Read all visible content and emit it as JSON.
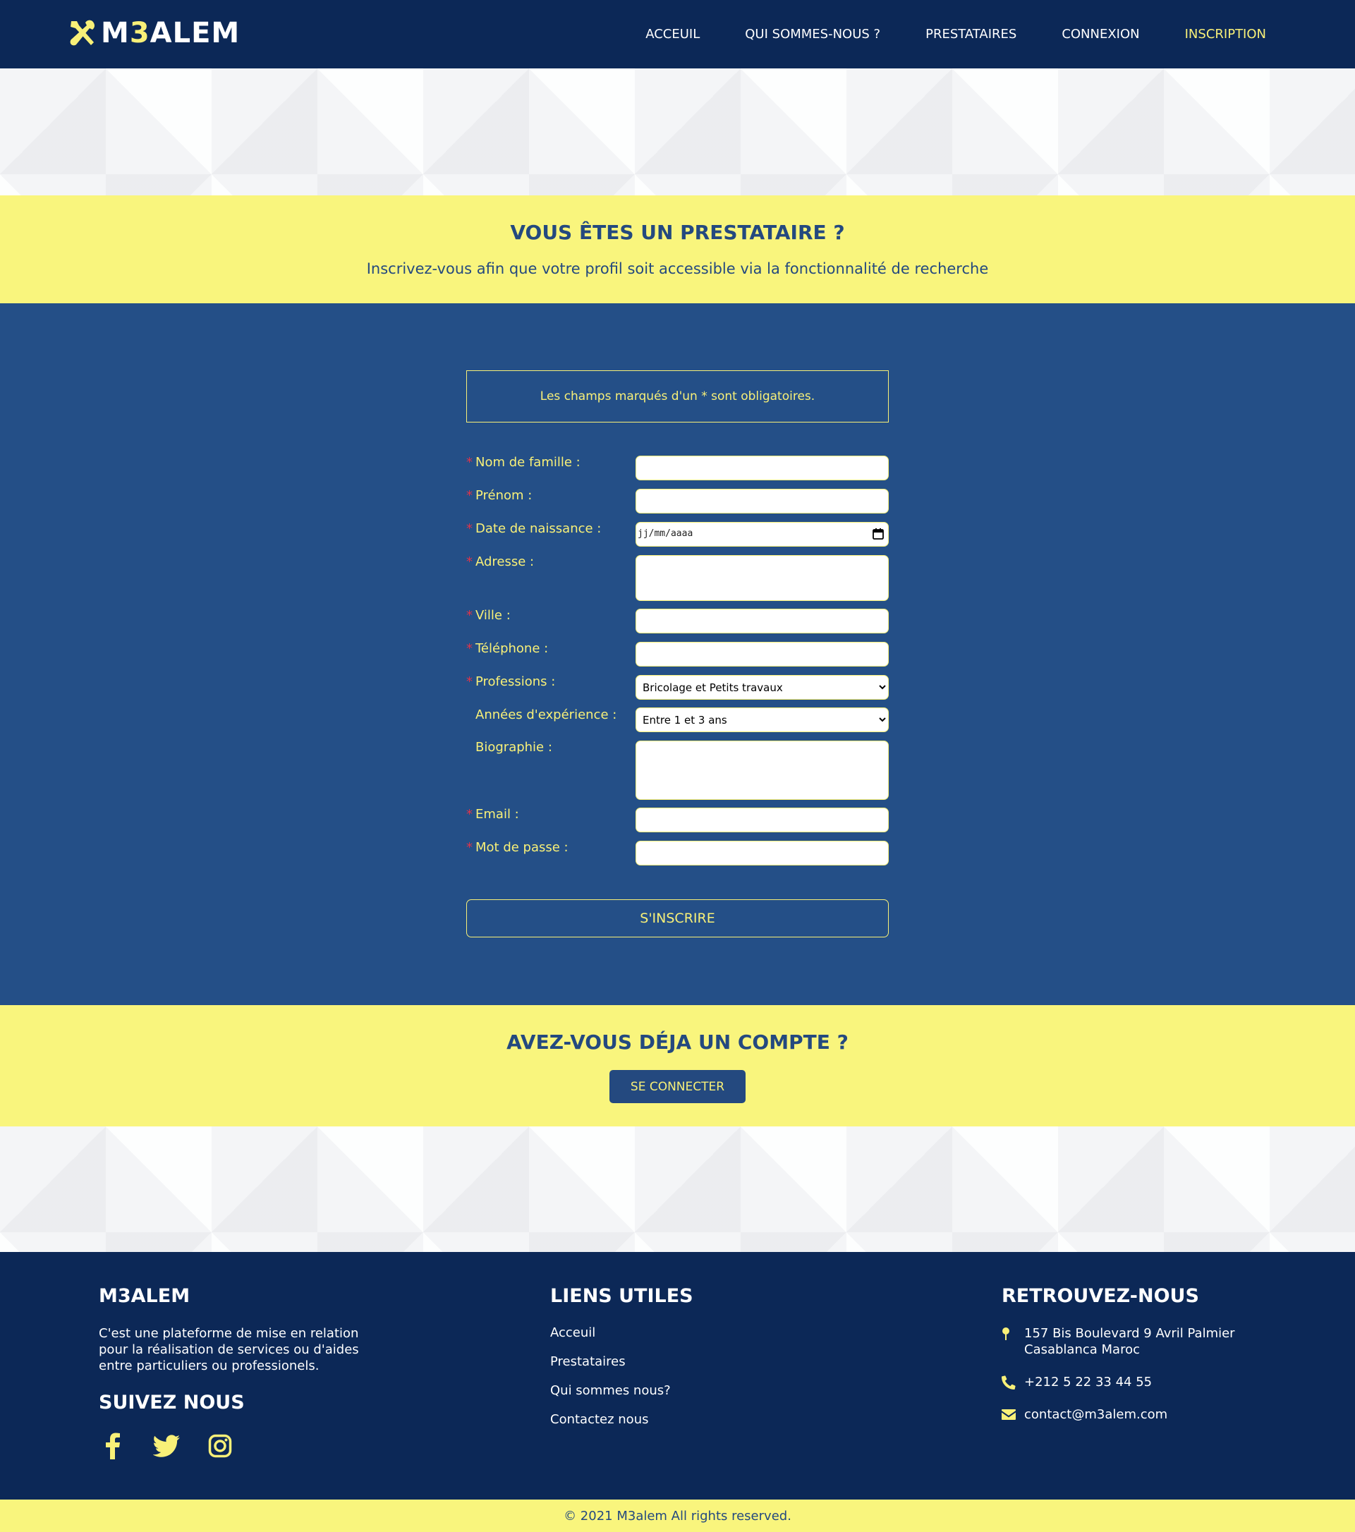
{
  "brand": {
    "logo_main": "M",
    "logo_accent": "3",
    "logo_end": "ALEM"
  },
  "nav": {
    "items": [
      {
        "label": "ACCEUIL"
      },
      {
        "label": "QUI SOMMES-NOUS ?"
      },
      {
        "label": "PRESTATAIRES"
      },
      {
        "label": "CONNEXION"
      },
      {
        "label": "INSCRIPTION"
      }
    ],
    "active_index": 4
  },
  "hero": {
    "title": "VOUS ÊTES UN PRESTATAIRE ?",
    "subtitle": "Inscrivez-vous afin que votre profil soit accessible via la fonctionnalité de recherche"
  },
  "form": {
    "notice": "Les champs marqués d'un * sont obligatoires.",
    "required_marker": "*",
    "fields": {
      "nom": {
        "label": "Nom de famille :",
        "value": ""
      },
      "prenom": {
        "label": "Prénom :",
        "value": ""
      },
      "naissance": {
        "label": "Date de naissance :",
        "placeholder": "jj/mm/aaaa"
      },
      "adresse": {
        "label": "Adresse :",
        "value": ""
      },
      "ville": {
        "label": "Ville :",
        "value": ""
      },
      "telephone": {
        "label": "Téléphone :",
        "value": ""
      },
      "professions": {
        "label": "Professions :",
        "selected": "Bricolage et Petits travaux"
      },
      "experience": {
        "label": "Années d'expérience :",
        "selected": "Entre 1 et 3 ans"
      },
      "biographie": {
        "label": "Biographie :",
        "value": ""
      },
      "email": {
        "label": "Email :",
        "value": ""
      },
      "password": {
        "label": "Mot de passe :",
        "value": ""
      }
    },
    "submit_label": "S'INSCRIRE"
  },
  "account": {
    "title": "AVEZ-VOUS DÉJA UN COMPTE ?",
    "button_label": "SE CONNECTER"
  },
  "footer": {
    "about": {
      "title": "M3ALEM",
      "text": "C'est une plateforme de mise en relation pour la réalisation de services ou d'aides entre particuliers ou professionels."
    },
    "social": {
      "title": "SUIVEZ NOUS",
      "icons": [
        "facebook-icon",
        "twitter-icon",
        "instagram-icon"
      ]
    },
    "links": {
      "title": "LIENS UTILES",
      "items": [
        {
          "label": "Acceuil"
        },
        {
          "label": "Prestataires"
        },
        {
          "label": "Qui sommes nous?"
        },
        {
          "label": "Contactez nous"
        }
      ]
    },
    "contact": {
      "title": "RETROUVEZ-NOUS",
      "address": "157 Bis Boulevard 9 Avril Palmier Casablanca Maroc",
      "phone": "+212 5 22 33 44 55",
      "email": "contact@m3alem.com"
    },
    "copyright": "© 2021 M3alem All rights reserved."
  },
  "colors": {
    "navy": "#0c2857",
    "blue": "#244f87",
    "accent_yellow": "#f8f078",
    "band_yellow": "#f9f57d",
    "heading_blue": "#24497f",
    "required_red": "#e0344a"
  }
}
